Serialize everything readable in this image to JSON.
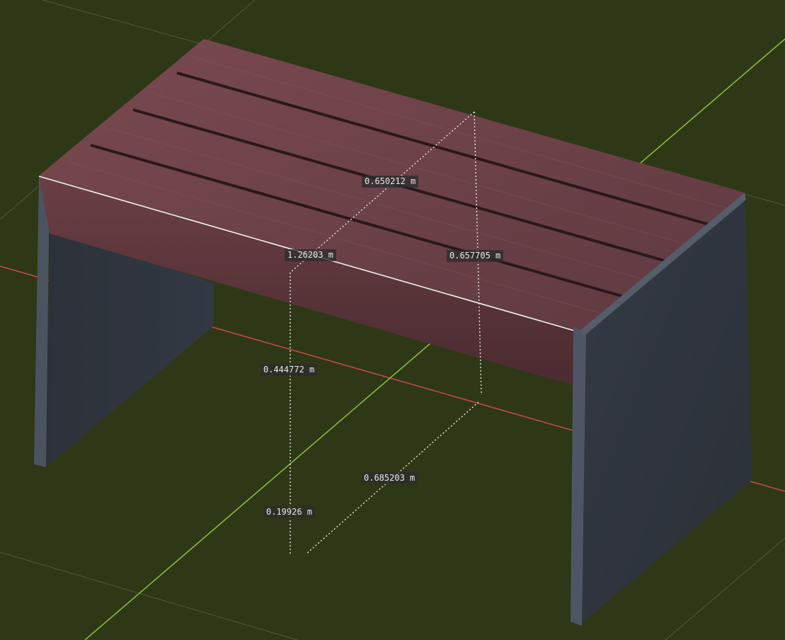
{
  "viewport": {
    "background_color": "#2e3816",
    "grid_color": "#5a6a4a",
    "x_axis_color": "#c84a4a",
    "y_axis_color": "#8ec040"
  },
  "object": {
    "seat_colors": [
      "#6e4248",
      "#5a3539",
      "#4a2b2f"
    ],
    "leg_colors": [
      "#3b414c",
      "#2f353e",
      "#4a5260"
    ]
  },
  "measurements": [
    {
      "value": "0.650212 m"
    },
    {
      "value": "1.26203 m"
    },
    {
      "value": "0.657705 m"
    },
    {
      "value": "0.444772 m"
    },
    {
      "value": "0.685203 m"
    },
    {
      "value": "0.19926 m"
    }
  ]
}
